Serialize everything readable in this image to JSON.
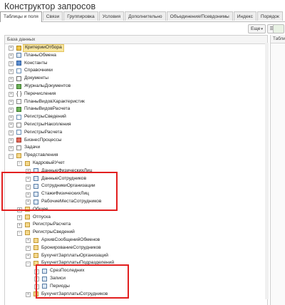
{
  "window": {
    "title": "Конструктор запросов"
  },
  "tabs": [
    {
      "label": "Таблицы и поля",
      "active": true
    },
    {
      "label": "Связи"
    },
    {
      "label": "Группировка"
    },
    {
      "label": "Условия"
    },
    {
      "label": "Дополнительно"
    },
    {
      "label": "Объединения/Псевдонимы"
    },
    {
      "label": "Индекс"
    },
    {
      "label": "Порядок"
    }
  ],
  "toolbar": {
    "more_label": "Еще",
    "more_arrow": "▾",
    "right_header": "Табли"
  },
  "tree": {
    "header": "База данных",
    "rows": [
      {
        "label": "КритерииОтбора",
        "level": 0,
        "icon": "i-sel",
        "selected": true
      },
      {
        "label": "ПланыОбмена",
        "level": 0,
        "icon": "i-tbl"
      },
      {
        "label": "Константы",
        "level": 0,
        "icon": "i-blue"
      },
      {
        "label": "Справочники",
        "level": 0,
        "icon": "i-grid"
      },
      {
        "label": "Документы",
        "level": 0,
        "icon": "i-doc"
      },
      {
        "label": "ЖурналыДокументов",
        "level": 0,
        "icon": "i-green"
      },
      {
        "label": "Перечисления",
        "level": 0,
        "icon": "i-enum"
      },
      {
        "label": "ПланыВидовХарактеристик",
        "level": 0,
        "icon": "i-grid2"
      },
      {
        "label": "ПланыВидовРасчета",
        "level": 0,
        "icon": "i-green"
      },
      {
        "label": "РегистрыСведений",
        "level": 0,
        "icon": "i-grid"
      },
      {
        "label": "РегистрыНакопления",
        "level": 0,
        "icon": "i-grid2"
      },
      {
        "label": "РегистрыРасчета",
        "level": 0,
        "icon": "i-grid"
      },
      {
        "label": "БизнесПроцессы",
        "level": 0,
        "icon": "i-red"
      },
      {
        "label": "Задачи",
        "level": 0,
        "icon": "i-grid2"
      },
      {
        "label": "Представления",
        "level": 0,
        "icon": "i-folder",
        "expanded": true
      },
      {
        "label": "КадровыйУчет",
        "level": 1,
        "icon": "i-folder",
        "expanded": true
      },
      {
        "label": "ДанныеФизическихЛиц",
        "level": 2,
        "icon": "i-tbl"
      },
      {
        "label": "ДанныеСотрудников",
        "level": 2,
        "icon": "i-tbl"
      },
      {
        "label": "СотрудникиОрганизации",
        "level": 2,
        "icon": "i-tbl"
      },
      {
        "label": "СтажиФизическихЛиц",
        "level": 2,
        "icon": "i-tbl"
      },
      {
        "label": "РабочиеМестаСотрудников",
        "level": 2,
        "icon": "i-tbl"
      },
      {
        "label": "Общее",
        "level": 1,
        "icon": "i-folder"
      },
      {
        "label": "Отпуска",
        "level": 1,
        "icon": "i-folder"
      },
      {
        "label": "РегистрыРасчета",
        "level": 1,
        "icon": "i-folder"
      },
      {
        "label": "РегистрыСведений",
        "level": 1,
        "icon": "i-folder",
        "expanded": true
      },
      {
        "label": "АрхивСообщенийОбменов",
        "level": 2,
        "icon": "i-folder"
      },
      {
        "label": "БронированиеСотрудников",
        "level": 2,
        "icon": "i-folder"
      },
      {
        "label": "БухучетЗарплатыОрганизаций",
        "level": 2,
        "icon": "i-folder"
      },
      {
        "label": "БухучетЗарплатыПодразделений",
        "level": 2,
        "icon": "i-folder",
        "expanded": true
      },
      {
        "label": "СрезПоследних",
        "level": 3,
        "icon": "i-tbl"
      },
      {
        "label": "Записи",
        "level": 3,
        "icon": "i-tbl"
      },
      {
        "label": "Периоды",
        "level": 3,
        "icon": "i-tbl"
      },
      {
        "label": "БухучетЗарплатыСотрудников",
        "level": 2,
        "icon": "i-folder"
      }
    ]
  },
  "highlight_color": "#e21f1f"
}
